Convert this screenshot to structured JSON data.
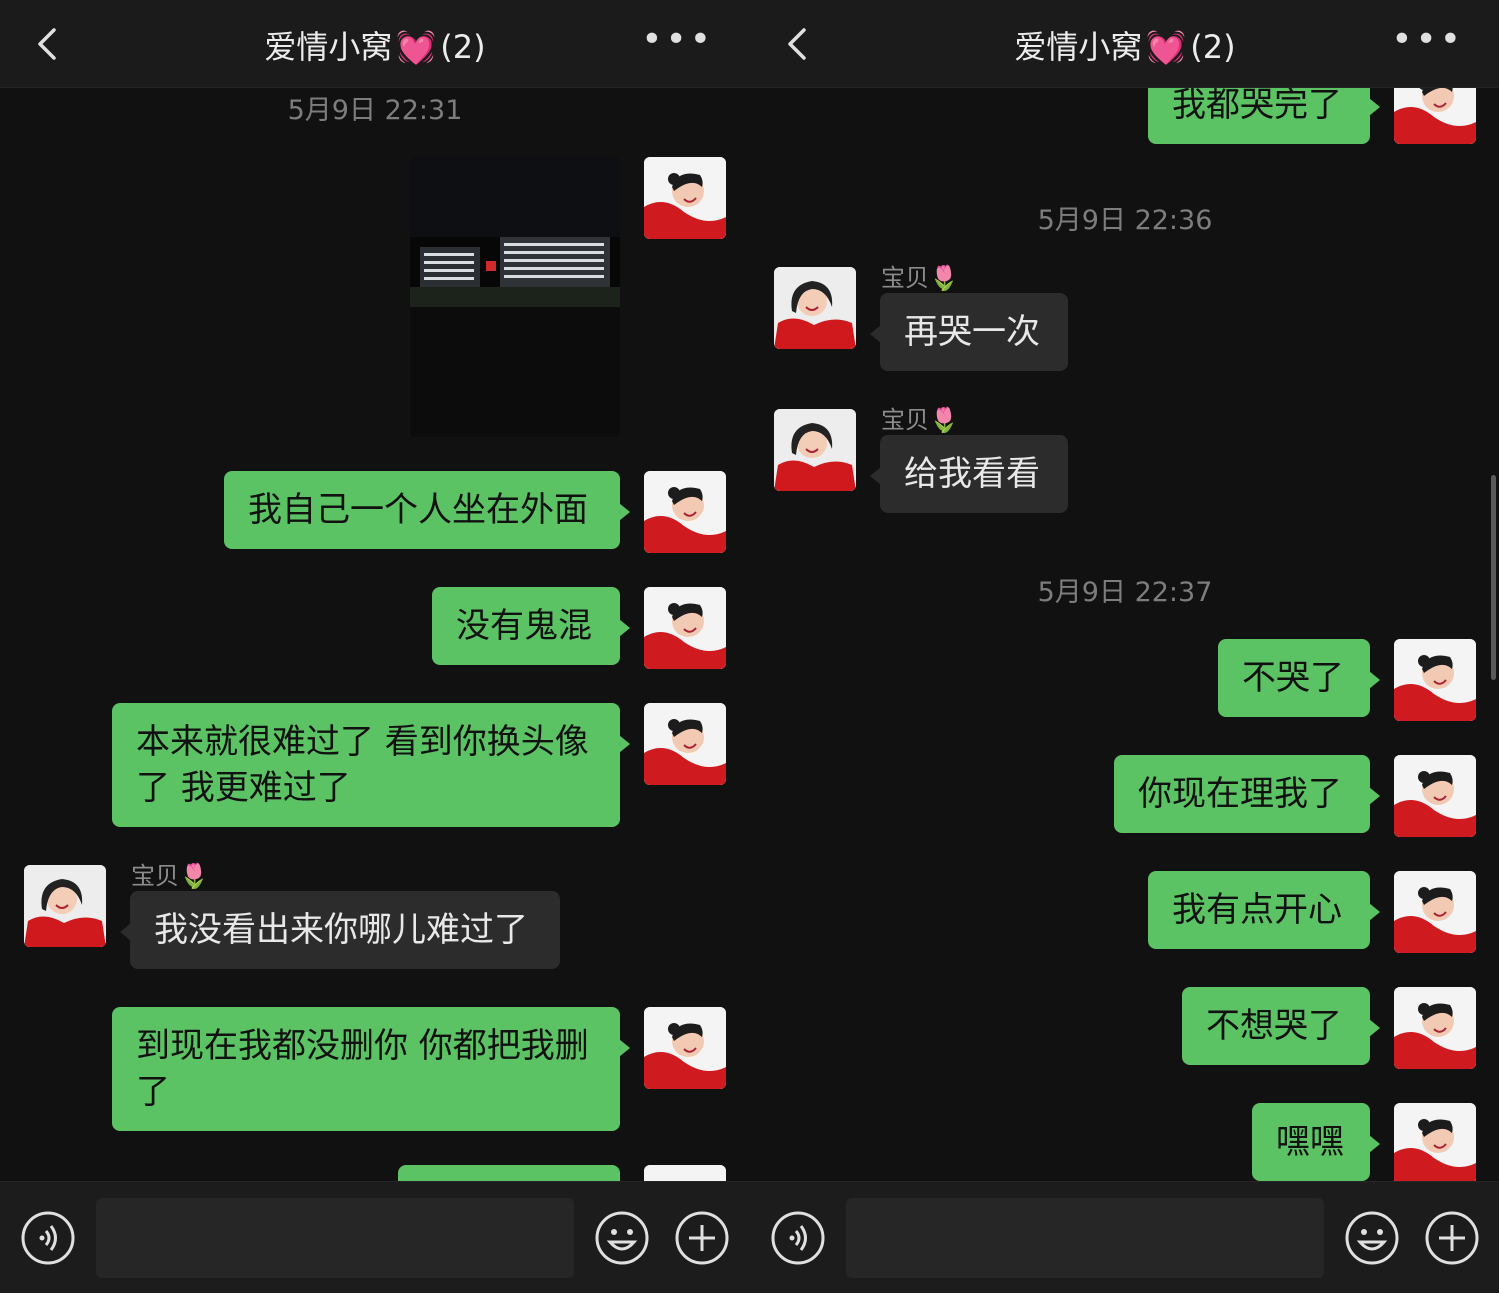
{
  "left": {
    "header": {
      "title": "爱情小窝",
      "heart": "💓",
      "count": "(2)",
      "more": "•••"
    },
    "timestamp": "5月9日 22:31",
    "messages": [
      "我自己一个人坐在外面",
      "没有鬼混",
      "本来就很难过了 看到你换头像了 我更难过了",
      "我没看出来你哪儿难过了",
      "到现在我都没删你 你都把我删了"
    ],
    "sender": "宝贝🌷"
  },
  "right": {
    "header": {
      "title": "爱情小窝",
      "heart": "💓",
      "count": "(2)",
      "more": "•••"
    },
    "messages": [
      "我都哭完了",
      "再哭一次",
      "给我看看",
      "不哭了",
      "你现在理我了",
      "我有点开心",
      "不想哭了",
      "嘿嘿"
    ],
    "timestamps": [
      "5月9日 22:36",
      "5月9日 22:37"
    ],
    "sender": "宝贝🌷"
  },
  "icons": [
    "back-arrow-icon",
    "more-dots-icon",
    "voice-icon",
    "emoji-icon",
    "plus-icon"
  ],
  "colors": {
    "outgoing_bubble": "#5bc364",
    "incoming_bubble": "#2c2c2c",
    "background": "#111111",
    "avatar_sweater": "#d0191d"
  }
}
